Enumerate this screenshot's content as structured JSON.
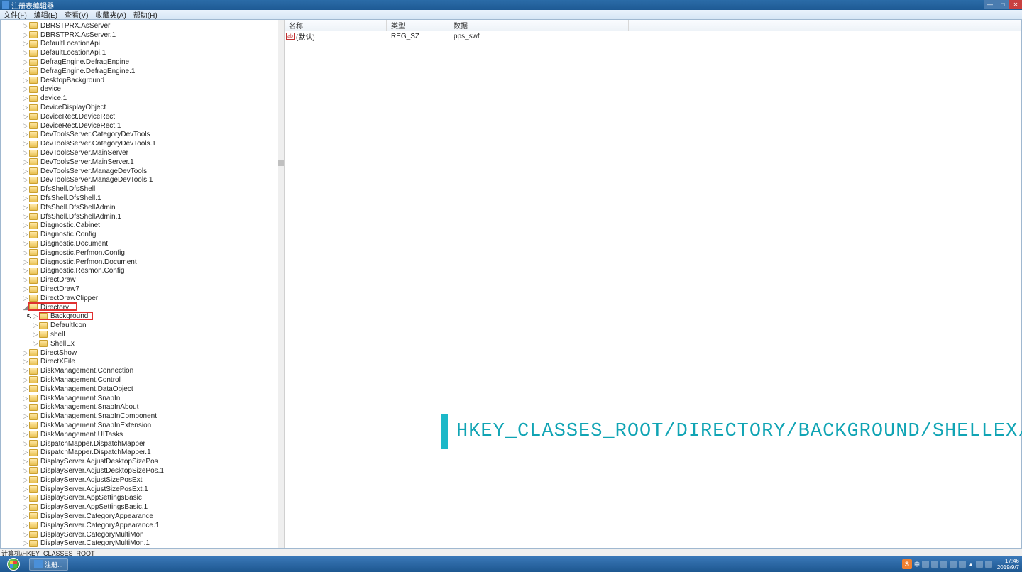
{
  "window": {
    "title": "注册表编辑器"
  },
  "menu": {
    "file": "文件(F)",
    "edit": "编辑(E)",
    "view": "查看(V)",
    "favorites": "收藏夹(A)",
    "help": "帮助(H)"
  },
  "tree": {
    "items_lvl0": [
      "DBRSTPRX.AsServer",
      "DBRSTPRX.AsServer.1",
      "DefaultLocationApi",
      "DefaultLocationApi.1",
      "DefragEngine.DefragEngine",
      "DefragEngine.DefragEngine.1",
      "DesktopBackground",
      "device",
      "device.1",
      "DeviceDisplayObject",
      "DeviceRect.DeviceRect",
      "DeviceRect.DeviceRect.1",
      "DevToolsServer.CategoryDevTools",
      "DevToolsServer.CategoryDevTools.1",
      "DevToolsServer.MainServer",
      "DevToolsServer.MainServer.1",
      "DevToolsServer.ManageDevTools",
      "DevToolsServer.ManageDevTools.1",
      "DfsShell.DfsShell",
      "DfsShell.DfsShell.1",
      "DfsShell.DfsShellAdmin",
      "DfsShell.DfsShellAdmin.1",
      "Diagnostic.Cabinet",
      "Diagnostic.Config",
      "Diagnostic.Document",
      "Diagnostic.Perfmon.Config",
      "Diagnostic.Perfmon.Document",
      "Diagnostic.Resmon.Config",
      "DirectDraw",
      "DirectDraw7",
      "DirectDrawClipper"
    ],
    "directory": "Directory",
    "directory_children": [
      "Background",
      "DefaultIcon",
      "shell",
      "ShellEx"
    ],
    "items_lvl0_after": [
      "DirectShow",
      "DirectXFile",
      "DiskManagement.Connection",
      "DiskManagement.Control",
      "DiskManagement.DataObject",
      "DiskManagement.SnapIn",
      "DiskManagement.SnapInAbout",
      "DiskManagement.SnapInComponent",
      "DiskManagement.SnapInExtension",
      "DiskManagement.UITasks",
      "DispatchMapper.DispatchMapper",
      "DispatchMapper.DispatchMapper.1",
      "DisplayServer.AdjustDesktopSizePos",
      "DisplayServer.AdjustDesktopSizePos.1",
      "DisplayServer.AdjustSizePosExt",
      "DisplayServer.AdjustSizePosExt.1",
      "DisplayServer.AppSettingsBasic",
      "DisplayServer.AppSettingsBasic.1",
      "DisplayServer.CategoryAppearance",
      "DisplayServer.CategoryAppearance.1",
      "DisplayServer.CategoryMultiMon",
      "DisplayServer.CategoryMultiMon.1"
    ]
  },
  "values": {
    "header": {
      "name": "名称",
      "type": "类型",
      "data": "数据"
    },
    "rows": [
      {
        "icon": "ab",
        "name": "(默认)",
        "type": "REG_SZ",
        "data": "pps_swf"
      }
    ]
  },
  "overlay": {
    "path": "HKEY_CLASSES_ROOT/DIRECTORY/BACKGROUND/SHELLEX/CONTEXTMENUHANDLERS"
  },
  "statusbar": {
    "path": "计算机\\HKEY_CLASSES_ROOT"
  },
  "taskbar": {
    "app": "注册...",
    "ime": "中",
    "clock_time": "17:46",
    "clock_date": "2019/9/7",
    "sogou": "S"
  }
}
